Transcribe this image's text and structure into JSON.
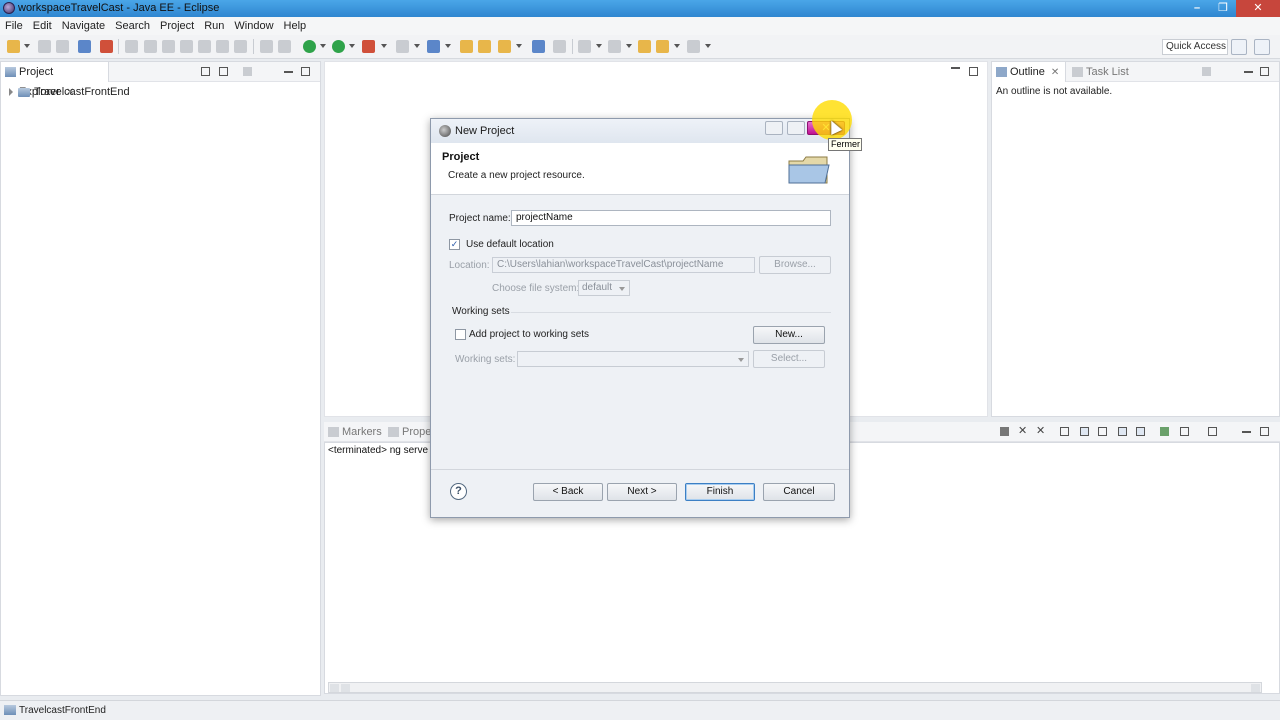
{
  "window": {
    "title": "workspaceTravelCast - Java EE - Eclipse"
  },
  "menu": [
    "File",
    "Edit",
    "Navigate",
    "Search",
    "Project",
    "Run",
    "Window",
    "Help"
  ],
  "toolbar": {
    "quick_access": "Quick Access"
  },
  "project_explorer": {
    "tab_label": "Project Explorer",
    "items": [
      {
        "label": "TravelcastFrontEnd"
      }
    ]
  },
  "outline": {
    "tab_label": "Outline",
    "task_list_label": "Task List",
    "message": "An outline is not available."
  },
  "console": {
    "tabs": [
      "Markers",
      "Proper"
    ],
    "text": "<terminated> ng serve"
  },
  "dialog": {
    "title": "New Project",
    "heading": "Project",
    "description": "Create a new project resource.",
    "close_tooltip": "Fermer",
    "project_name_label": "Project name:",
    "project_name_value": "projectName",
    "use_default_location_label": "Use default location",
    "use_default_location_checked": true,
    "location_label": "Location:",
    "location_value": "C:\\Users\\lahian\\workspaceTravelCast\\projectName",
    "browse_label": "Browse...",
    "file_system_label": "Choose file system:",
    "file_system_value": "default",
    "working_sets_group_label": "Working sets",
    "add_to_working_sets_label": "Add project to working sets",
    "add_to_working_sets_checked": false,
    "new_button": "New...",
    "working_sets_label": "Working sets:",
    "working_sets_value": "",
    "select_button": "Select...",
    "help_icon": "?",
    "back_button": "< Back",
    "next_button": "Next >",
    "finish_button": "Finish",
    "cancel_button": "Cancel"
  },
  "statusbar": {
    "text": "TravelcastFrontEnd"
  }
}
